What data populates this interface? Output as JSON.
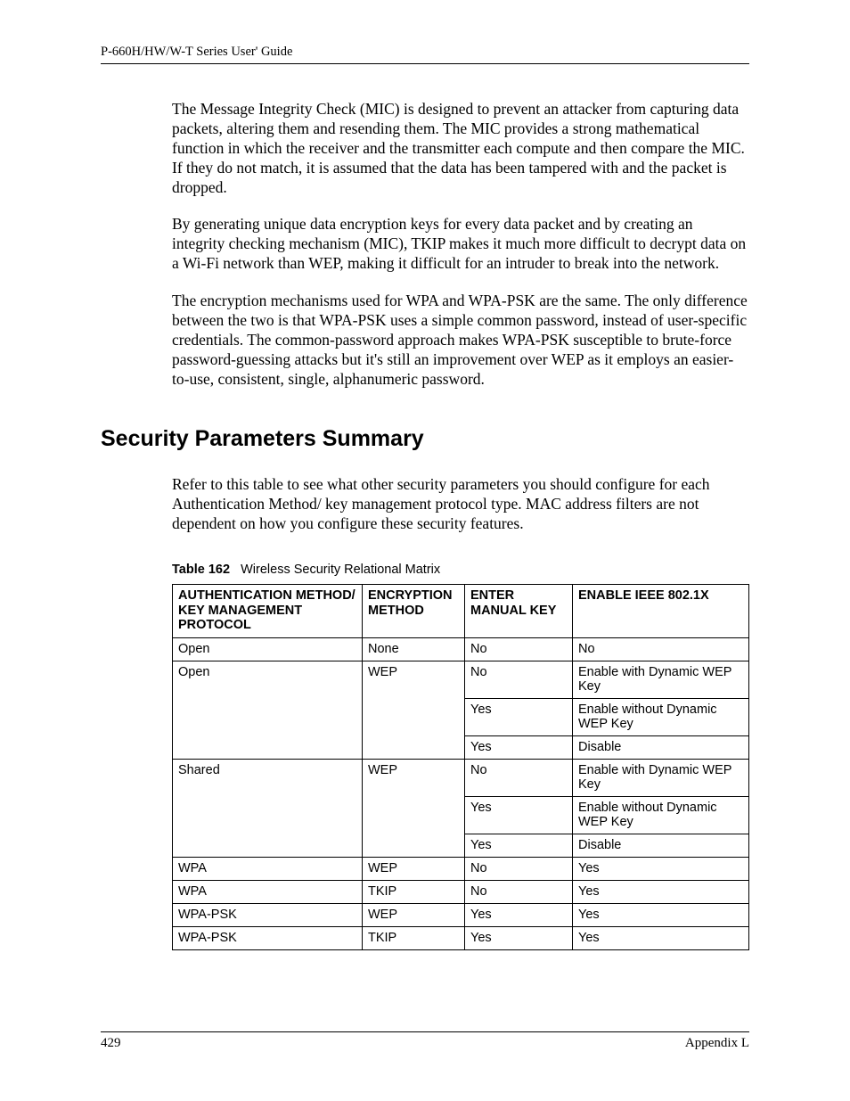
{
  "header": {
    "title": "P-660H/HW/W-T Series User' Guide"
  },
  "paragraphs": {
    "p1": "The Message Integrity Check (MIC) is designed to prevent an attacker from capturing data packets, altering them and resending them. The MIC provides a strong mathematical function in which the receiver and the transmitter each compute and then compare the MIC. If they do not match, it is assumed that the data has been tampered with and the packet is dropped.",
    "p2": "By generating unique data encryption keys for every data packet and by creating an integrity checking mechanism (MIC), TKIP makes it much more difficult to decrypt data on a Wi-Fi network than WEP, making it difficult for an intruder to break into the network.",
    "p3": "The encryption mechanisms used for WPA and WPA-PSK are the same. The only difference between the two is that WPA-PSK uses a simple common password, instead of user-specific credentials. The common-password approach makes WPA-PSK susceptible to brute-force password-guessing attacks but it's still an improvement over WEP as it employs an easier-to-use, consistent, single, alphanumeric password."
  },
  "section": {
    "heading": "Security Parameters Summary",
    "intro": "Refer to this table to see what other security parameters you should configure for each Authentication Method/ key management protocol type. MAC address filters are not dependent on how you configure these security features."
  },
  "table": {
    "caption_label": "Table 162",
    "caption_text": "Wireless Security Relational Matrix",
    "headers": {
      "c1": "AUTHENTICATION METHOD/ KEY MANAGEMENT PROTOCOL",
      "c2": "ENCRYPTION METHOD",
      "c3": "ENTER MANUAL KEY",
      "c4": "ENABLE IEEE 802.1X"
    },
    "rows": [
      {
        "c1": "Open",
        "c2": "None",
        "c3": "No",
        "c4": "No"
      },
      {
        "c1": "Open",
        "c2": "WEP",
        "c3": "No",
        "c4": "Enable with Dynamic WEP Key"
      },
      {
        "c1": "",
        "c2": "",
        "c3": "Yes",
        "c4": "Enable without Dynamic WEP Key"
      },
      {
        "c1": "",
        "c2": "",
        "c3": "Yes",
        "c4": "Disable"
      },
      {
        "c1": "Shared",
        "c2": "WEP",
        "c3": "No",
        "c4": "Enable with Dynamic WEP Key"
      },
      {
        "c1": "",
        "c2": "",
        "c3": "Yes",
        "c4": "Enable without Dynamic WEP Key"
      },
      {
        "c1": "",
        "c2": "",
        "c3": "Yes",
        "c4": "Disable"
      },
      {
        "c1": "WPA",
        "c2": "WEP",
        "c3": "No",
        "c4": "Yes"
      },
      {
        "c1": "WPA",
        "c2": "TKIP",
        "c3": "No",
        "c4": "Yes"
      },
      {
        "c1": "WPA-PSK",
        "c2": "WEP",
        "c3": "Yes",
        "c4": "Yes"
      },
      {
        "c1": "WPA-PSK",
        "c2": "TKIP",
        "c3": "Yes",
        "c4": "Yes"
      }
    ]
  },
  "footer": {
    "page": "429",
    "appendix": "Appendix L"
  }
}
